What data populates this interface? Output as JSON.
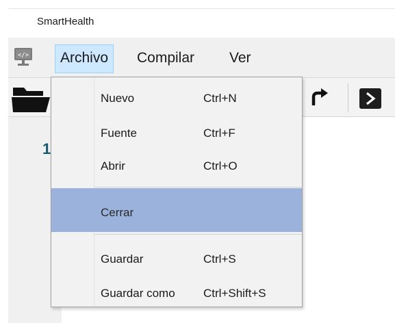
{
  "window": {
    "title": "SmartHealth"
  },
  "menubar": {
    "items": [
      {
        "label": "Archivo",
        "active": true
      },
      {
        "label": "Compilar",
        "active": false
      },
      {
        "label": "Ver",
        "active": false
      }
    ]
  },
  "toolbar": {
    "icons": [
      "folder-icon",
      "redo-icon",
      "run-icon"
    ]
  },
  "editor": {
    "first_line_number": "1"
  },
  "dropdown": {
    "items": [
      {
        "label": "Nuevo",
        "shortcut": "Ctrl+N"
      },
      {
        "label": "Fuente",
        "shortcut": "Ctrl+F"
      },
      {
        "label": "Abrir",
        "shortcut": "Ctrl+O"
      },
      {
        "label": "Cerrar",
        "shortcut": "",
        "highlighted": true
      },
      {
        "label": "Guardar",
        "shortcut": "Ctrl+S"
      },
      {
        "label": "Guardar como",
        "shortcut": "Ctrl+Shift+S"
      }
    ]
  },
  "colors": {
    "menu_active_bg": "#cde8ff",
    "item_highlight_bg": "#9bb3dc",
    "line_number_color": "#175a6b"
  }
}
